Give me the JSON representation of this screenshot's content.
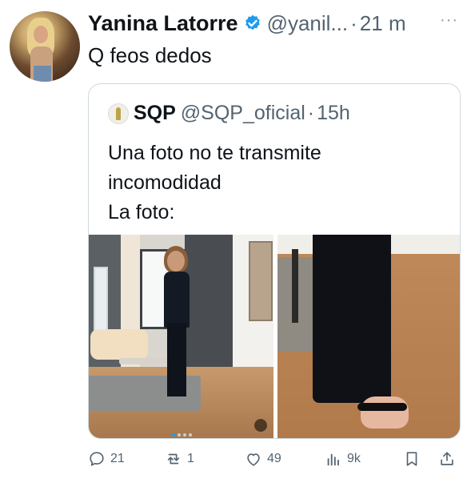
{
  "tweet": {
    "author_name": "Yanina Latorre",
    "author_handle": "@yanil...",
    "separator": "·",
    "time": "21 m",
    "more_label": "···",
    "text": "Q feos dedos"
  },
  "quote": {
    "author_name": "SQP",
    "author_handle": "@SQP_oficial",
    "separator": "·",
    "time": "15h",
    "text_lines": [
      "Una foto no te transmite",
      "incomodidad",
      "La foto:"
    ]
  },
  "actions": {
    "replies": "21",
    "reposts": "1",
    "likes": "49",
    "views": "9k"
  },
  "colors": {
    "text_primary": "#0f1419",
    "text_secondary": "#536471",
    "verified_blue": "#1d9bf0",
    "border": "#cfd9de"
  },
  "icons": {
    "verified": "verified-badge-icon",
    "reply": "reply-icon",
    "repost": "repost-icon",
    "like": "like-icon",
    "views": "views-icon",
    "bookmark": "bookmark-icon",
    "share": "share-icon"
  }
}
